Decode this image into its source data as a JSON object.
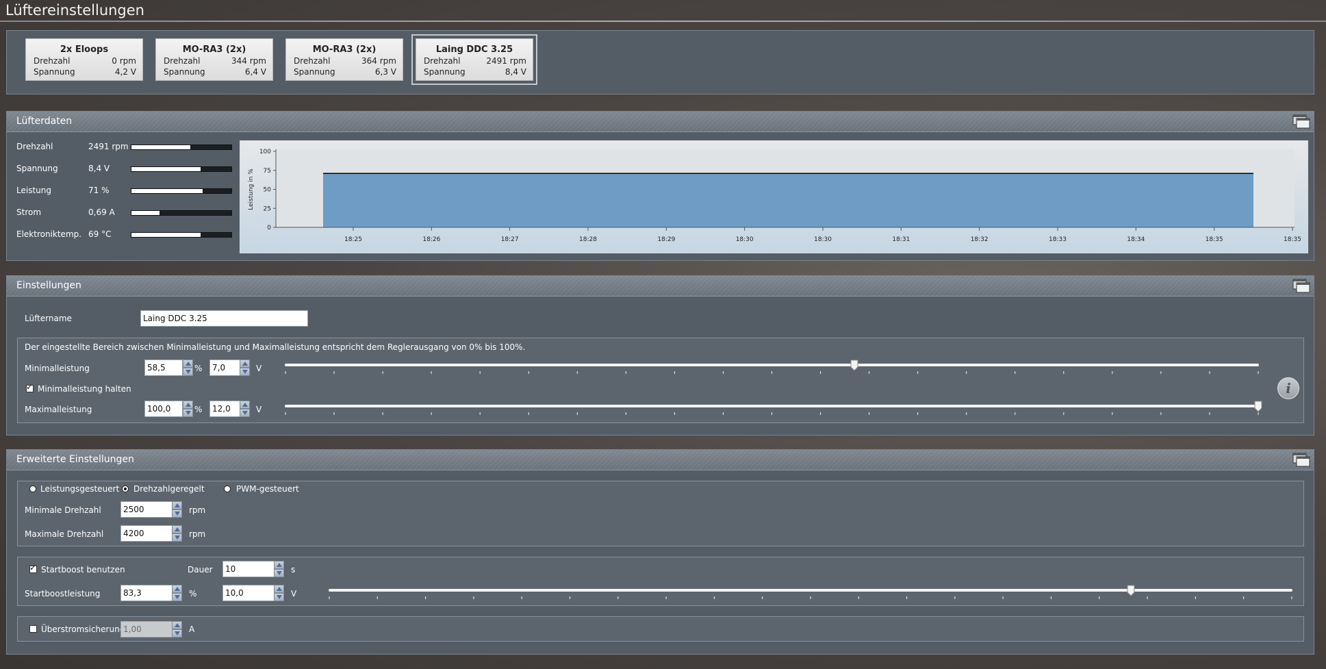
{
  "page": {
    "title": "Lüftereinstellungen"
  },
  "fans": [
    {
      "name": "2x Eloops",
      "speed_label": "Drehzahl",
      "speed": "0 rpm",
      "voltage_label": "Spannung",
      "voltage": "4,2 V"
    },
    {
      "name": "MO-RA3 (2x)",
      "speed_label": "Drehzahl",
      "speed": "344 rpm",
      "voltage_label": "Spannung",
      "voltage": "6,4 V"
    },
    {
      "name": "MO-RA3 (2x)",
      "speed_label": "Drehzahl",
      "speed": "364 rpm",
      "voltage_label": "Spannung",
      "voltage": "6,3 V"
    },
    {
      "name": "Laing DDC 3.25",
      "speed_label": "Drehzahl",
      "speed": "2491 rpm",
      "voltage_label": "Spannung",
      "voltage": "8,4 V"
    }
  ],
  "live": {
    "title": "Lüfterdaten",
    "rows": [
      {
        "label": "Drehzahl",
        "value": "2491 rpm",
        "level": 0.59
      },
      {
        "label": "Spannung",
        "value": "8,4 V",
        "level": 0.69
      },
      {
        "label": "Leistung",
        "value": "71 %",
        "level": 0.71
      },
      {
        "label": "Strom",
        "value": "0,69 A",
        "level": 0.28
      },
      {
        "label": "Elektroniktemp.",
        "value": "69 °C",
        "level": 0.69
      }
    ]
  },
  "chart_data": {
    "type": "area",
    "ylabel": "Leistung in %",
    "xlabel": "",
    "ylim": [
      0,
      100
    ],
    "yticks": [
      "100",
      "75",
      "50",
      "25",
      "0"
    ],
    "xticks": [
      "18:25",
      "18:26",
      "18:27",
      "18:28",
      "18:29",
      "18:30",
      "18:30",
      "18:31",
      "18:32",
      "18:33",
      "18:34",
      "18:35",
      "18:35"
    ],
    "series": [
      {
        "values": [
          71,
          71
        ]
      }
    ],
    "fill_color": "#6e9cc4",
    "line_color": "#000000",
    "grid": false
  },
  "settings": {
    "title": "Einstellungen",
    "name_label": "Lüftername",
    "name_value": "Laing DDC 3.25",
    "range_note": "Der eingestellte Bereich zwischen Minimalleistung und Maximalleistung entspricht dem Reglerausgang von 0% bis 100%.",
    "min_label": "Minimalleistung",
    "min_percent": "58,5",
    "min_volt": "7,0",
    "hold_min_label": "Minimalleistung halten",
    "hold_min_checked": true,
    "max_label": "Maximalleistung",
    "max_percent": "100,0",
    "max_volt": "12,0",
    "unit_percent": "%",
    "unit_volt": "V",
    "min_slider_level": 0.585,
    "max_slider_level": 1.0
  },
  "advanced": {
    "title": "Erweiterte Einstellungen",
    "modes": [
      "Leistungsgesteuert",
      "Drehzahlgeregelt",
      "PWM-gesteuert"
    ],
    "selected_mode": "Drehzahlgeregelt",
    "min_rpm_label": "Minimale Drehzahl",
    "min_rpm": "2500",
    "max_rpm_label": "Maximale Drehzahl",
    "max_rpm": "4200",
    "unit_rpm": "rpm",
    "startboost_label": "Startboost benutzen",
    "startboost_checked": true,
    "duration_label": "Dauer",
    "duration": "10",
    "unit_s": "s",
    "boost_power_label": "Startboostleistung",
    "boost_percent": "83,3",
    "boost_volt": "10,0",
    "unit_percent": "%",
    "unit_volt": "V",
    "boost_slider_level": 0.833,
    "overcurrent_label": "Überstromsicherung",
    "overcurrent_checked": false,
    "overcurrent_value": "1,00",
    "unit_amp": "A"
  }
}
